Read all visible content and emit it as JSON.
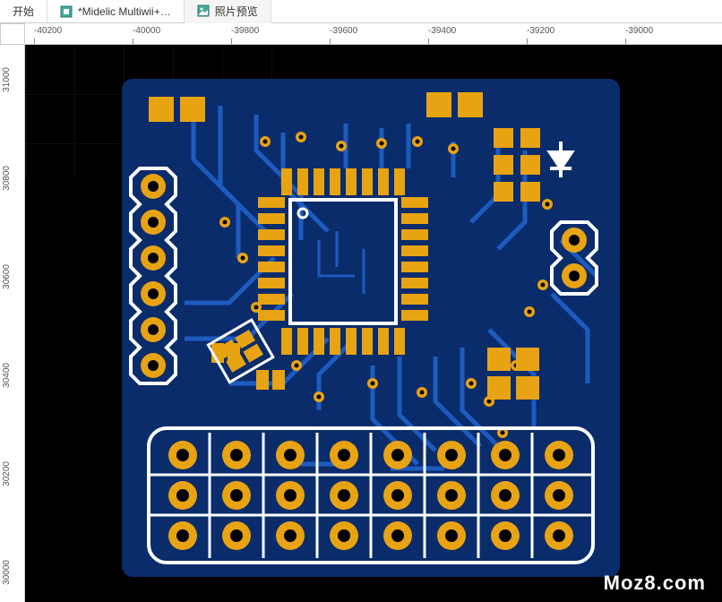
{
  "tabs": [
    {
      "label": "开始",
      "icon": "home"
    },
    {
      "label": "*Midelic Multiwii+…",
      "icon": "board"
    },
    {
      "label": "照片预览",
      "icon": "photo"
    }
  ],
  "ruler": {
    "top_ticks": [
      "-40200",
      "-40000",
      "-39800",
      "-39600",
      "-39400",
      "-39200",
      "-39000"
    ],
    "left_ticks": [
      "31000",
      "30800",
      "30600",
      "30400",
      "30200",
      "30000"
    ]
  },
  "colors": {
    "solder_mask": "#0a2c6b",
    "copper": "#e8a313",
    "silkscreen": "#ffffff",
    "hole": "#000000",
    "canvas_bg": "#000000",
    "grid_line": "#1a1a1a"
  },
  "pcb": {
    "board_label": "PCB board preview",
    "components": {
      "qfp_chip": "32-pin QFP IC",
      "diode_symbol": "D",
      "smd_pads": "surface-mount pads",
      "through_holes": "plated through-holes"
    }
  },
  "watermark": "Moz8.com"
}
